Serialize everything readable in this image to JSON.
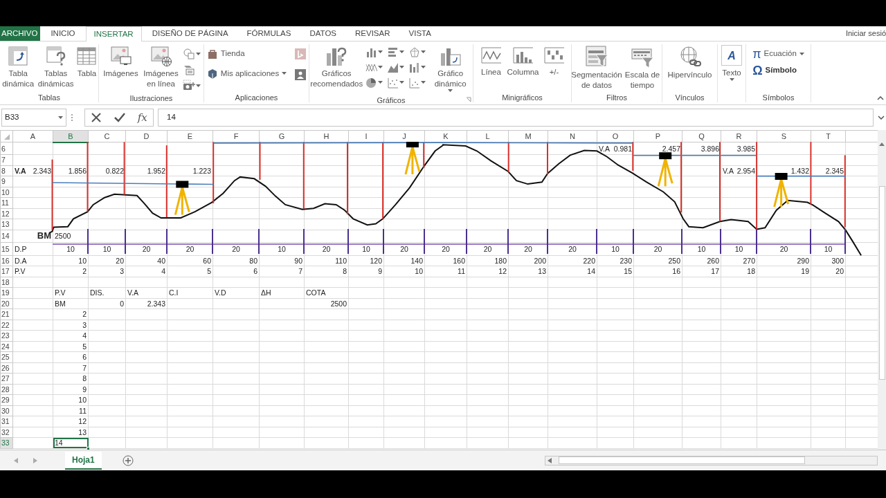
{
  "ribbon_tabs": [
    {
      "label": "ARCHIVO",
      "kind": "file",
      "selected": false
    },
    {
      "label": "INICIO",
      "kind": "tab",
      "selected": false
    },
    {
      "label": "INSERTAR",
      "kind": "tab",
      "selected": true
    },
    {
      "label": "DISEÑO DE PÁGINA",
      "kind": "tab",
      "selected": false
    },
    {
      "label": "FÓRMULAS",
      "kind": "tab",
      "selected": false
    },
    {
      "label": "DATOS",
      "kind": "tab",
      "selected": false
    },
    {
      "label": "REVISAR",
      "kind": "tab",
      "selected": false
    },
    {
      "label": "VISTA",
      "kind": "tab",
      "selected": false
    }
  ],
  "account": {
    "label": "Iniciar sesió"
  },
  "ribbon_groups": [
    {
      "label": "Tablas",
      "buttons": [
        {
          "label": "Tabla dinámica"
        },
        {
          "label": "Tablas dinámicas"
        },
        {
          "label": "Tabla"
        }
      ]
    },
    {
      "label": "Ilustraciones",
      "buttons": [
        {
          "label": "Imágenes"
        },
        {
          "label": "Imágenes en línea"
        }
      ]
    },
    {
      "label": "Aplicaciones",
      "buttons": [
        {
          "label": "Tienda"
        },
        {
          "label": "Mis aplicaciones"
        }
      ]
    },
    {
      "label": "Gráficos",
      "buttons": [
        {
          "label": "Gráficos recomendados"
        },
        {
          "label": "Gráfico dinámico"
        }
      ]
    },
    {
      "label": "Minigráficos",
      "buttons": [
        {
          "label": "Línea"
        },
        {
          "label": "Columna"
        },
        {
          "label": "+/-"
        }
      ]
    },
    {
      "label": "Filtros",
      "buttons": [
        {
          "label": "Segmentación de datos"
        },
        {
          "label": "Escala de tiempo"
        }
      ]
    },
    {
      "label": "Vínculos",
      "buttons": [
        {
          "label": "Hipervínculo"
        }
      ]
    },
    {
      "buttons": [
        {
          "label": "Texto",
          "icon_char": "A"
        }
      ]
    },
    {
      "label": "Símbolos",
      "buttons": [
        {
          "label": "Ecuación",
          "icon_char": "π"
        },
        {
          "label": "Símbolo",
          "icon_char": "Ω"
        }
      ]
    }
  ],
  "formula_bar": {
    "name_box": "B33",
    "function_label": "fx",
    "formula": "14"
  },
  "columns": [
    {
      "label": "A",
      "selected": false
    },
    {
      "label": "B",
      "selected": true
    },
    {
      "label": "C",
      "selected": false
    },
    {
      "label": "D",
      "selected": false
    },
    {
      "label": "E",
      "selected": false
    },
    {
      "label": "F",
      "selected": false
    },
    {
      "label": "G",
      "selected": false
    },
    {
      "label": "H",
      "selected": false
    },
    {
      "label": "I",
      "selected": false
    },
    {
      "label": "J",
      "selected": false
    },
    {
      "label": "K",
      "selected": false
    },
    {
      "label": "L",
      "selected": false
    },
    {
      "label": "M",
      "selected": false
    },
    {
      "label": "N",
      "selected": false
    },
    {
      "label": "O",
      "selected": false
    },
    {
      "label": "P",
      "selected": false
    },
    {
      "label": "Q",
      "selected": false
    },
    {
      "label": "R",
      "selected": false
    },
    {
      "label": "S",
      "selected": false
    },
    {
      "label": "T",
      "selected": false
    }
  ],
  "rows": [
    {
      "number": "6",
      "selected": false,
      "cells": [
        null,
        null,
        null,
        null,
        null,
        null,
        null,
        null,
        null,
        null,
        null,
        null,
        null,
        null,
        {
          "label": "V.A",
          "text": "0.981",
          "kind": "number"
        },
        {
          "text": "2.457",
          "kind": "number"
        },
        {
          "text": "3.896",
          "kind": "number"
        },
        {
          "text": "3.985",
          "kind": "number"
        }
      ]
    },
    {
      "number": "7",
      "selected": false
    },
    {
      "number": "8",
      "selected": false,
      "cells": [
        {
          "label": "V.A",
          "bold": true,
          "text": "2.343",
          "kind": "number"
        },
        {
          "text": "1.856",
          "kind": "number"
        },
        {
          "text": "0.822",
          "kind": "number"
        },
        {
          "text": "1.952",
          "kind": "number"
        },
        {
          "text": "1.223",
          "kind": "number"
        },
        null,
        null,
        null,
        null,
        null,
        null,
        null,
        null,
        null,
        null,
        null,
        null,
        {
          "label": "V.A",
          "text": "2.954",
          "kind": "number"
        },
        {
          "text": "1.432",
          "kind": "number"
        },
        {
          "text": "2.345",
          "kind": "number"
        }
      ]
    },
    {
      "number": "9",
      "selected": false
    },
    {
      "number": "10",
      "selected": false
    },
    {
      "number": "11",
      "selected": false
    },
    {
      "number": "12",
      "selected": false
    },
    {
      "number": "13",
      "selected": false
    },
    {
      "number": "14",
      "selected": false,
      "cells": [
        {
          "text": "BM",
          "kind": "marker"
        },
        {
          "text": "2500",
          "kind": "text"
        }
      ]
    },
    {
      "number": "15",
      "selected": false,
      "centered": true,
      "cells": [
        {
          "text": "D.P",
          "kind": "text"
        },
        {
          "text": "10",
          "kind": "number"
        },
        {
          "text": "10",
          "kind": "number"
        },
        {
          "text": "20",
          "kind": "number"
        },
        {
          "text": "20",
          "kind": "number"
        },
        {
          "text": "20",
          "kind": "number"
        },
        {
          "text": "10",
          "kind": "number"
        },
        {
          "text": "20",
          "kind": "number"
        },
        {
          "text": "10",
          "kind": "number"
        },
        {
          "text": "20",
          "kind": "number"
        },
        {
          "text": "20",
          "kind": "number"
        },
        {
          "text": "20",
          "kind": "number"
        },
        {
          "text": "20",
          "kind": "number"
        },
        {
          "text": "20",
          "kind": "number"
        },
        {
          "text": "10",
          "kind": "number"
        },
        {
          "text": "20",
          "kind": "number"
        },
        {
          "text": "10",
          "kind": "number"
        },
        {
          "text": "10",
          "kind": "number"
        },
        {
          "text": "20",
          "kind": "number"
        },
        {
          "text": "10",
          "kind": "number"
        }
      ]
    },
    {
      "number": "16",
      "selected": false,
      "cells": [
        {
          "text": "D.A",
          "kind": "text"
        },
        {
          "text": "10",
          "kind": "number"
        },
        {
          "text": "20",
          "kind": "number"
        },
        {
          "text": "40",
          "kind": "number"
        },
        {
          "text": "60",
          "kind": "number"
        },
        {
          "text": "80",
          "kind": "number"
        },
        {
          "text": "90",
          "kind": "number"
        },
        {
          "text": "110",
          "kind": "number"
        },
        {
          "text": "120",
          "kind": "number"
        },
        {
          "text": "140",
          "kind": "number"
        },
        {
          "text": "160",
          "kind": "number"
        },
        {
          "text": "180",
          "kind": "number"
        },
        {
          "text": "200",
          "kind": "number"
        },
        {
          "text": "220",
          "kind": "number"
        },
        {
          "text": "230",
          "kind": "number"
        },
        {
          "text": "250",
          "kind": "number"
        },
        {
          "text": "260",
          "kind": "number"
        },
        {
          "text": "270",
          "kind": "number"
        },
        {
          "text": "290",
          "kind": "number"
        },
        {
          "text": "300",
          "kind": "number"
        }
      ]
    },
    {
      "number": "17",
      "selected": false,
      "cells": [
        {
          "text": "P.V",
          "kind": "text"
        },
        {
          "text": "2",
          "kind": "number"
        },
        {
          "text": "3",
          "kind": "number"
        },
        {
          "text": "4",
          "kind": "number"
        },
        {
          "text": "5",
          "kind": "number"
        },
        {
          "text": "6",
          "kind": "number"
        },
        {
          "text": "7",
          "kind": "number"
        },
        {
          "text": "8",
          "kind": "number"
        },
        {
          "text": "9",
          "kind": "number"
        },
        {
          "text": "10",
          "kind": "number"
        },
        {
          "text": "11",
          "kind": "number"
        },
        {
          "text": "12",
          "kind": "number"
        },
        {
          "text": "13",
          "kind": "number"
        },
        {
          "text": "14",
          "kind": "number"
        },
        {
          "text": "15",
          "kind": "number"
        },
        {
          "text": "16",
          "kind": "number"
        },
        {
          "text": "17",
          "kind": "number"
        },
        {
          "text": "18",
          "kind": "number"
        },
        {
          "text": "19",
          "kind": "number"
        },
        {
          "text": "20",
          "kind": "number"
        }
      ]
    },
    {
      "number": "18",
      "selected": false
    },
    {
      "number": "19",
      "selected": false,
      "cells": [
        null,
        {
          "text": "P.V",
          "kind": "text"
        },
        {
          "text": "DIS.",
          "kind": "text"
        },
        {
          "text": "V.A",
          "kind": "text"
        },
        {
          "text": "C.I",
          "kind": "text"
        },
        {
          "text": "V.D",
          "kind": "text"
        },
        {
          "text": "ΔH",
          "kind": "text"
        },
        {
          "text": "COTA",
          "kind": "text"
        }
      ]
    },
    {
      "number": "20",
      "selected": false,
      "cells": [
        null,
        {
          "text": "BM",
          "kind": "text"
        },
        {
          "text": "0",
          "kind": "number"
        },
        {
          "text": "2.343",
          "kind": "number"
        },
        null,
        null,
        null,
        {
          "text": "2500",
          "kind": "number"
        }
      ]
    },
    {
      "number": "21",
      "selected": false,
      "cells": [
        null,
        {
          "text": "2",
          "kind": "number"
        }
      ]
    },
    {
      "number": "22",
      "selected": false,
      "cells": [
        null,
        {
          "text": "3",
          "kind": "number"
        }
      ]
    },
    {
      "number": "23",
      "selected": false,
      "cells": [
        null,
        {
          "text": "4",
          "kind": "number"
        }
      ]
    },
    {
      "number": "24",
      "selected": false,
      "cells": [
        null,
        {
          "text": "5",
          "kind": "number"
        }
      ]
    },
    {
      "number": "25",
      "selected": false,
      "cells": [
        null,
        {
          "text": "6",
          "kind": "number"
        }
      ]
    },
    {
      "number": "26",
      "selected": false,
      "cells": [
        null,
        {
          "text": "7",
          "kind": "number"
        }
      ]
    },
    {
      "number": "27",
      "selected": false,
      "cells": [
        null,
        {
          "text": "8",
          "kind": "number"
        }
      ]
    },
    {
      "number": "28",
      "selected": false,
      "cells": [
        null,
        {
          "text": "9",
          "kind": "number"
        }
      ]
    },
    {
      "number": "29",
      "selected": false,
      "cells": [
        null,
        {
          "text": "10",
          "kind": "number"
        }
      ]
    },
    {
      "number": "30",
      "selected": false,
      "cells": [
        null,
        {
          "text": "11",
          "kind": "number"
        }
      ]
    },
    {
      "number": "31",
      "selected": false,
      "cells": [
        null,
        {
          "text": "12",
          "kind": "number"
        }
      ]
    },
    {
      "number": "32",
      "selected": false,
      "cells": [
        null,
        {
          "text": "13",
          "kind": "number"
        }
      ]
    },
    {
      "number": "33",
      "selected": true,
      "cells": [
        null,
        {
          "text": "14",
          "kind": "text",
          "selected": true
        }
      ]
    }
  ],
  "sheet_tabs": [
    {
      "label": "Hoja1",
      "selected": true
    }
  ]
}
